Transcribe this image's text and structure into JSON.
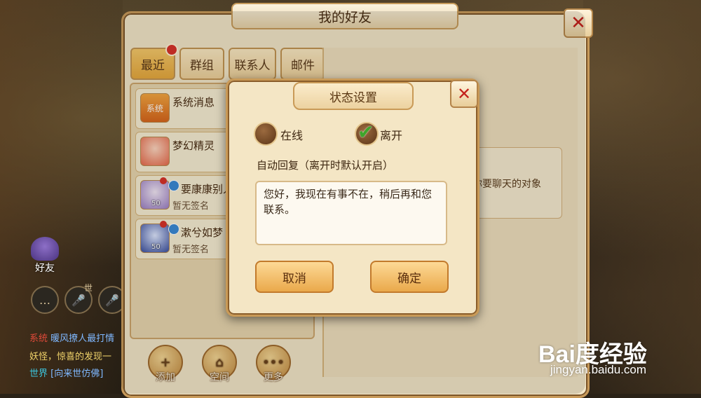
{
  "window": {
    "title": "我的好友"
  },
  "tabs": [
    {
      "label": "最近"
    },
    {
      "label": "群组"
    },
    {
      "label": "联系人"
    },
    {
      "label": "邮件"
    }
  ],
  "friends": [
    {
      "name": "系统消息",
      "sign": "",
      "avatar_text": "系统"
    },
    {
      "name": "梦幻精灵",
      "sign": "",
      "avatar_text": ""
    },
    {
      "name": "要康康别人",
      "sign": "暂无签名",
      "level": "50"
    },
    {
      "name": "漱兮如梦",
      "sign": "暂无签名",
      "level": "50"
    }
  ],
  "right_panel": {
    "hint": "选你要聊天的对象"
  },
  "bottom_actions": [
    {
      "label": "添加"
    },
    {
      "label": "空间"
    },
    {
      "label": "更多"
    }
  ],
  "hud": {
    "friends_label": "好友",
    "world_label": "世",
    "chat": [
      {
        "channel": "系统",
        "text": "暖风撩人最打情"
      },
      {
        "channel": "",
        "text": "妖怪，惊喜的发现一"
      },
      {
        "channel": "世界",
        "text": "[向来世仿佛]"
      }
    ]
  },
  "dialog": {
    "title": "状态设置",
    "option_online": "在线",
    "option_away": "离开",
    "selected": "离开",
    "auto_reply_label": "自动回复（离开时默认开启）",
    "auto_reply_text": "您好，我现在有事不在，稍后再和您联系。",
    "cancel_label": "取消",
    "confirm_label": "确定"
  },
  "watermark": {
    "logo": "Bai度经验",
    "url": "jingyan.baidu.com"
  },
  "colors": {
    "accent": "#e7a93d",
    "close": "#c4221c",
    "check": "#3ea52b"
  }
}
